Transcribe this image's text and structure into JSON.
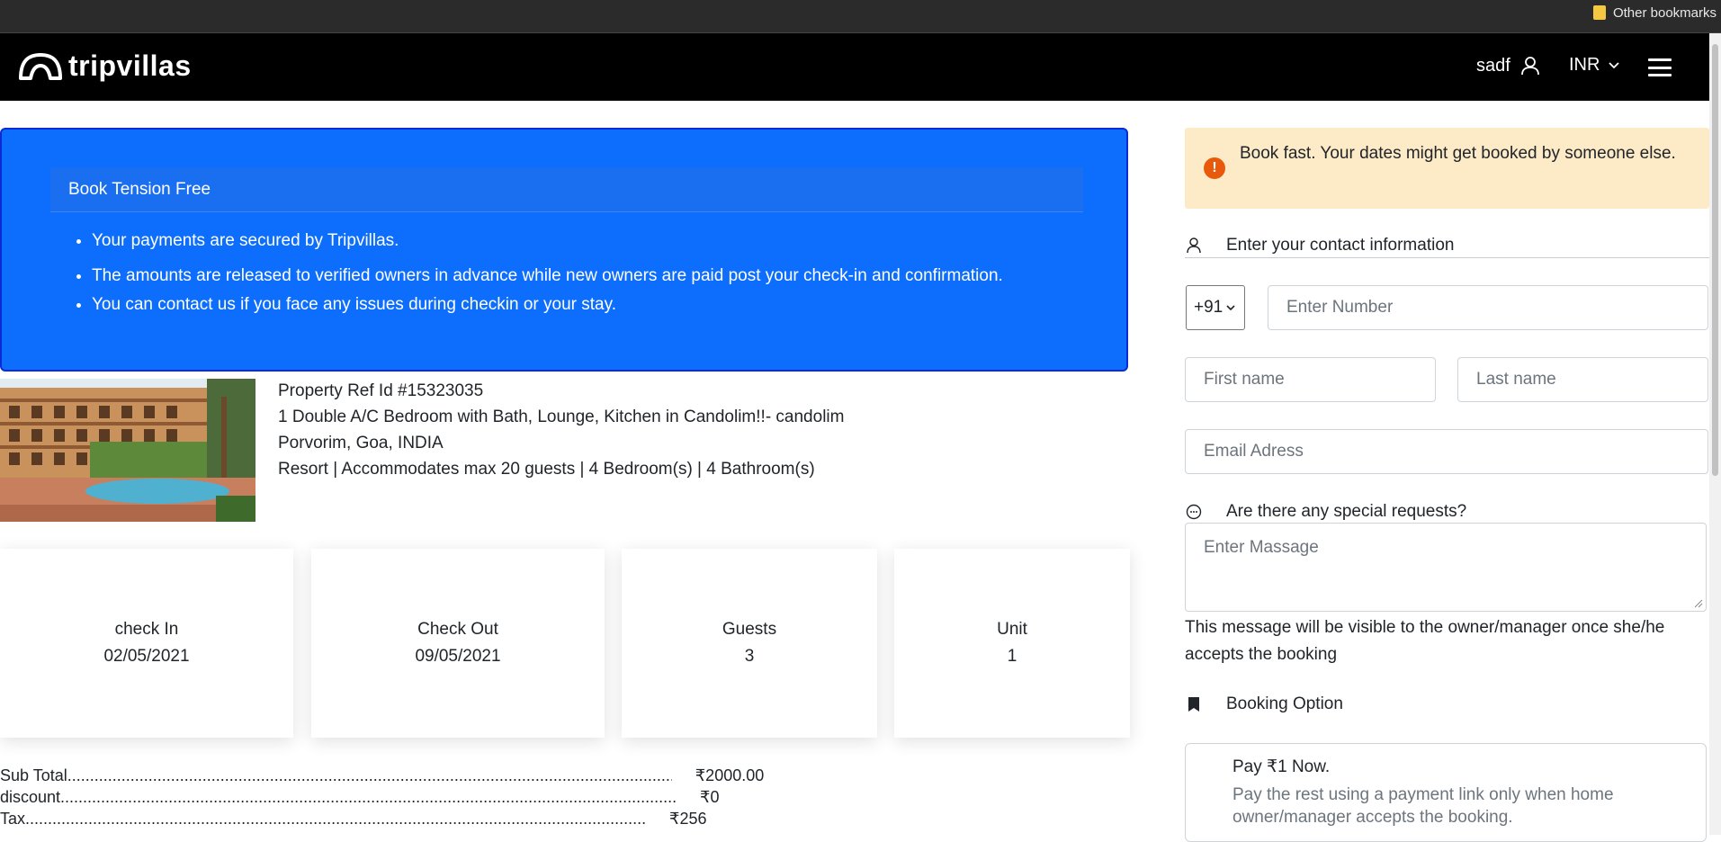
{
  "browser": {
    "bookmark_folder": "Other bookmarks"
  },
  "navbar": {
    "brand": "tripvillas",
    "user": "sadf",
    "currency": "INR"
  },
  "info_box": {
    "title": "Book Tension Free",
    "items": [
      "Your payments are secured by Tripvillas.",
      "The amounts are released to verified owners in advance while new owners are paid post your check-in and confirmation.",
      "You can contact us if you face any issues during checkin or your stay."
    ]
  },
  "property": {
    "ref": "Property Ref Id #15323035",
    "name": "1 Double A/C Bedroom with Bath, Lounge, Kitchen in Candolim!!- candolim",
    "location": "Porvorim, Goa, INDIA",
    "details": "Resort | Accommodates max 20 guests | 4 Bedroom(s) | 4 Bathroom(s)"
  },
  "stats": {
    "checkin": {
      "label": "check In",
      "value": "02/05/2021"
    },
    "checkout": {
      "label": "Check Out",
      "value": "09/05/2021"
    },
    "guests": {
      "label": "Guests",
      "value": "3"
    },
    "unit": {
      "label": "Unit",
      "value": "1"
    }
  },
  "price": {
    "subtotal": {
      "label": "Sub Total",
      "value": "₹2000.00"
    },
    "discount": {
      "label": "discount",
      "value": "₹0"
    },
    "tax": {
      "label": "Tax",
      "value": "₹256"
    }
  },
  "alert": {
    "text": "Book fast. Your dates might get booked by someone else."
  },
  "contact": {
    "heading": "Enter your contact information",
    "country_code": "+91",
    "phone_placeholder": "Enter Number",
    "first_name_placeholder": "First name",
    "last_name_placeholder": "Last name",
    "email_placeholder": "Email Adress"
  },
  "requests": {
    "heading": "Are there any special requests?",
    "placeholder": "Enter Massage",
    "note": "This message will be visible to the owner/manager once she/he accepts the booking"
  },
  "booking_option": {
    "heading": "Booking Option",
    "title": "Pay ₹1 Now.",
    "desc": "Pay the rest using a payment link only when home owner/manager accepts the booking."
  },
  "colors": {
    "navbar": "#000000",
    "info_box": "#0d6efd",
    "alert_bg": "#fdebc8",
    "alert_icon": "#e8590c"
  }
}
